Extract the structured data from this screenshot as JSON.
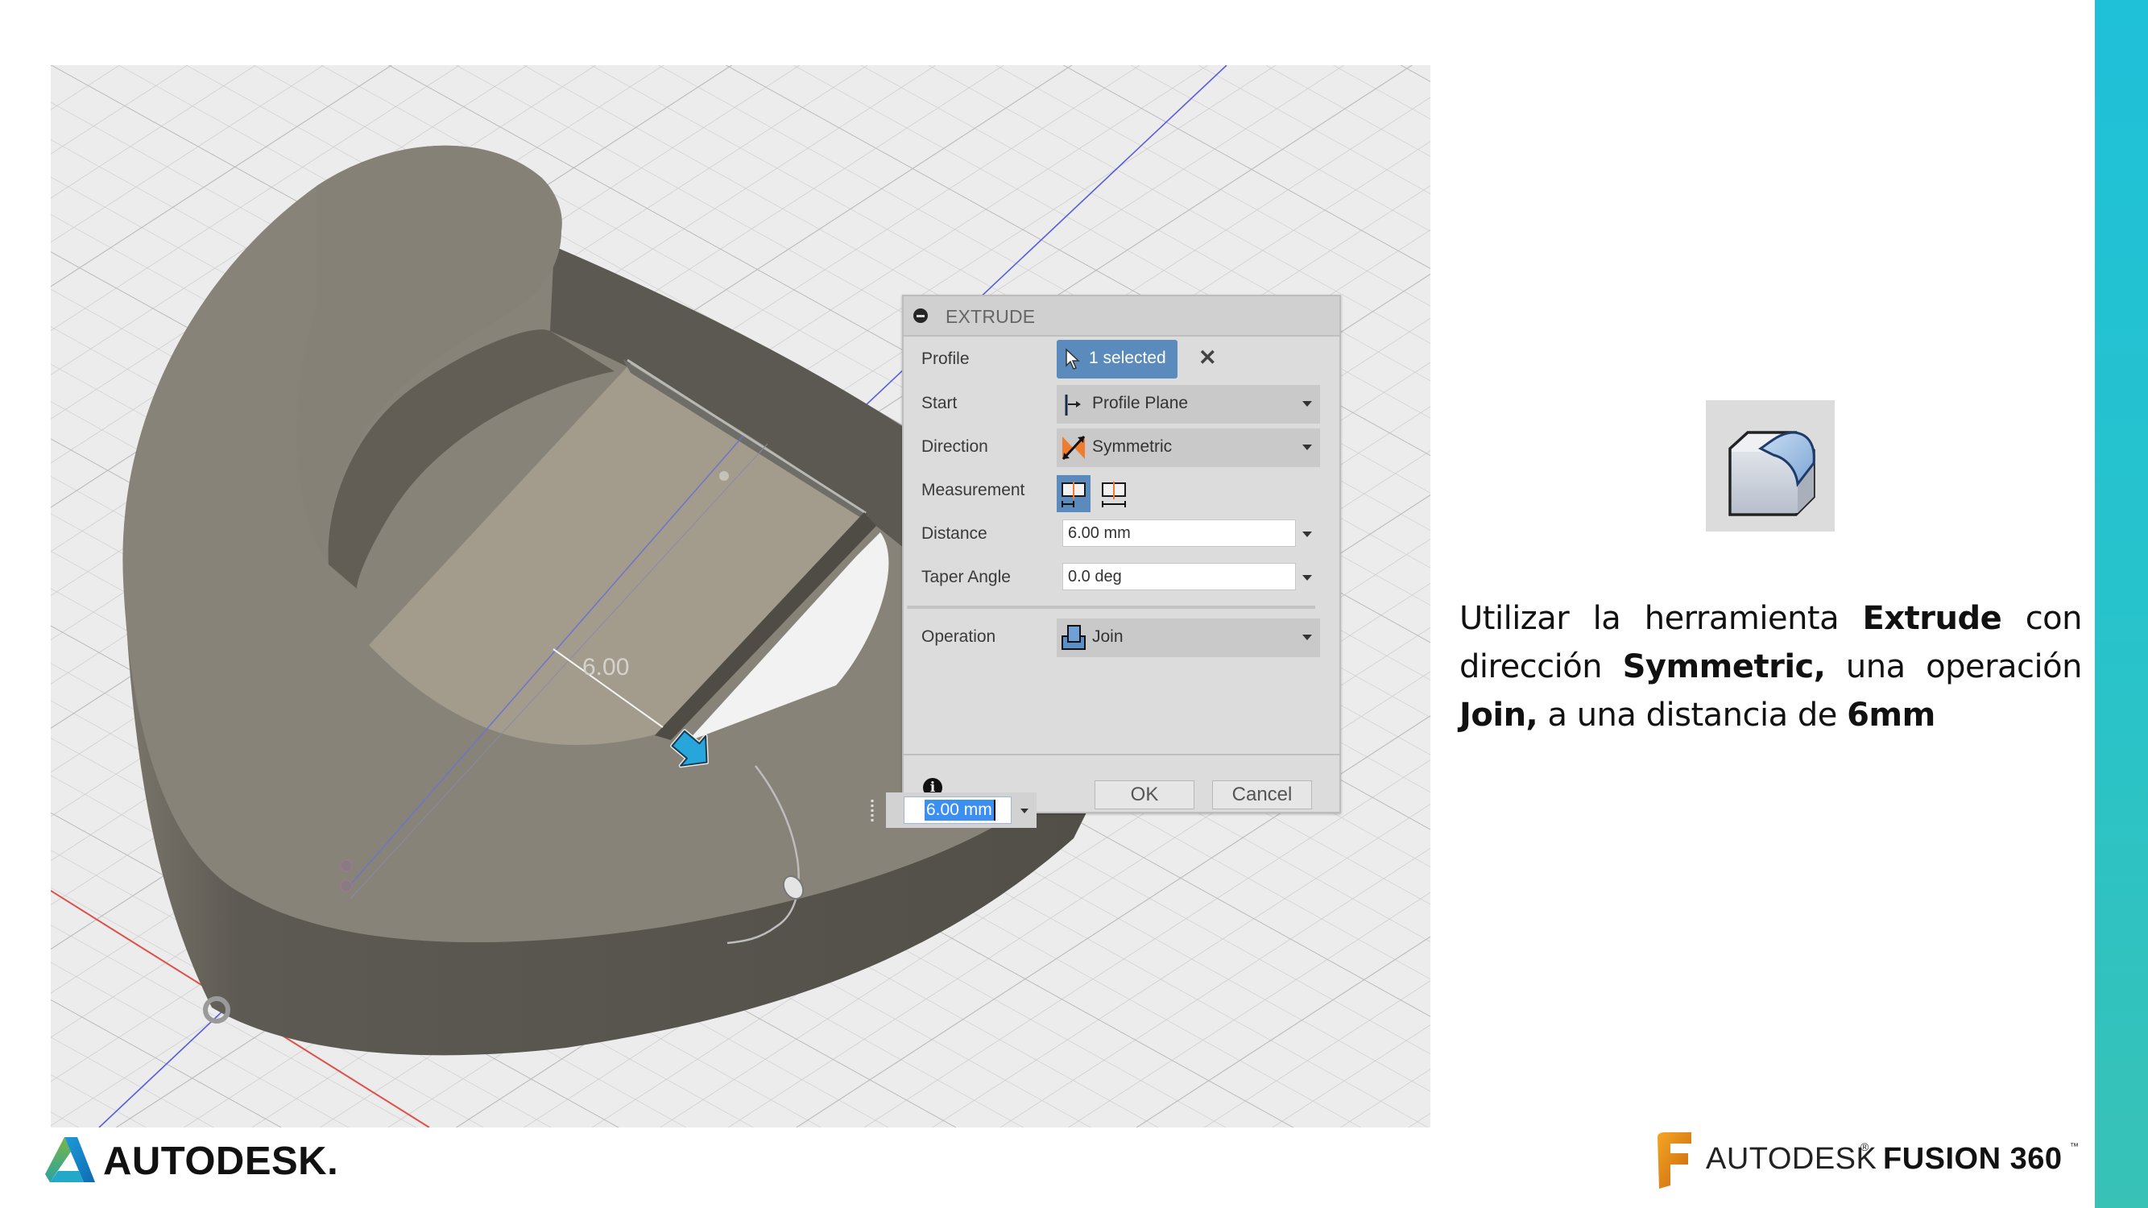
{
  "viewport": {
    "dimension_label": "6.00",
    "inline_distance_value": "6.00 mm",
    "colors": {
      "grid_bg": "#ececec",
      "body_top": "#878379",
      "body_side": "#56534c",
      "profile_face": "#a39c8d",
      "x_axis": "#e0504a",
      "z_axis": "#5b5bdd",
      "manipulator_arrow": "#27a6dc"
    }
  },
  "dialog": {
    "title": "EXTRUDE",
    "rows": {
      "profile": {
        "label": "Profile",
        "value": "1 selected"
      },
      "start": {
        "label": "Start",
        "value": "Profile Plane"
      },
      "direction": {
        "label": "Direction",
        "value": "Symmetric"
      },
      "measurement": {
        "label": "Measurement",
        "options": [
          "half-length",
          "whole-length"
        ],
        "selected": "half-length"
      },
      "distance": {
        "label": "Distance",
        "value": "6.00 mm"
      },
      "taper_angle": {
        "label": "Taper Angle",
        "value": "0.0 deg"
      },
      "operation": {
        "label": "Operation",
        "value": "Join"
      }
    },
    "ok_label": "OK",
    "cancel_label": "Cancel",
    "accent_color": "#5b8bbd"
  },
  "side": {
    "tool_icon": "extrude-tool-icon",
    "instruction_parts": [
      {
        "text": "Utilizar la herramienta ",
        "bold": false
      },
      {
        "text": "Extrude",
        "bold": true
      },
      {
        "text": " con dirección ",
        "bold": false
      },
      {
        "text": "Symmetric,",
        "bold": true
      },
      {
        "text": " una operación ",
        "bold": false
      },
      {
        "text": "Join,",
        "bold": true
      },
      {
        "text": " a una distancia de ",
        "bold": false
      },
      {
        "text": "6mm",
        "bold": true
      }
    ],
    "teal_color": "#27c3cc"
  },
  "footer": {
    "autodesk_logo_text": "AUTODESK.",
    "fusion_logo_text_1": "AUTODESK",
    "fusion_logo_reg": "®",
    "fusion_logo_text_2": "FUSION 360",
    "fusion_logo_tm": "™"
  }
}
